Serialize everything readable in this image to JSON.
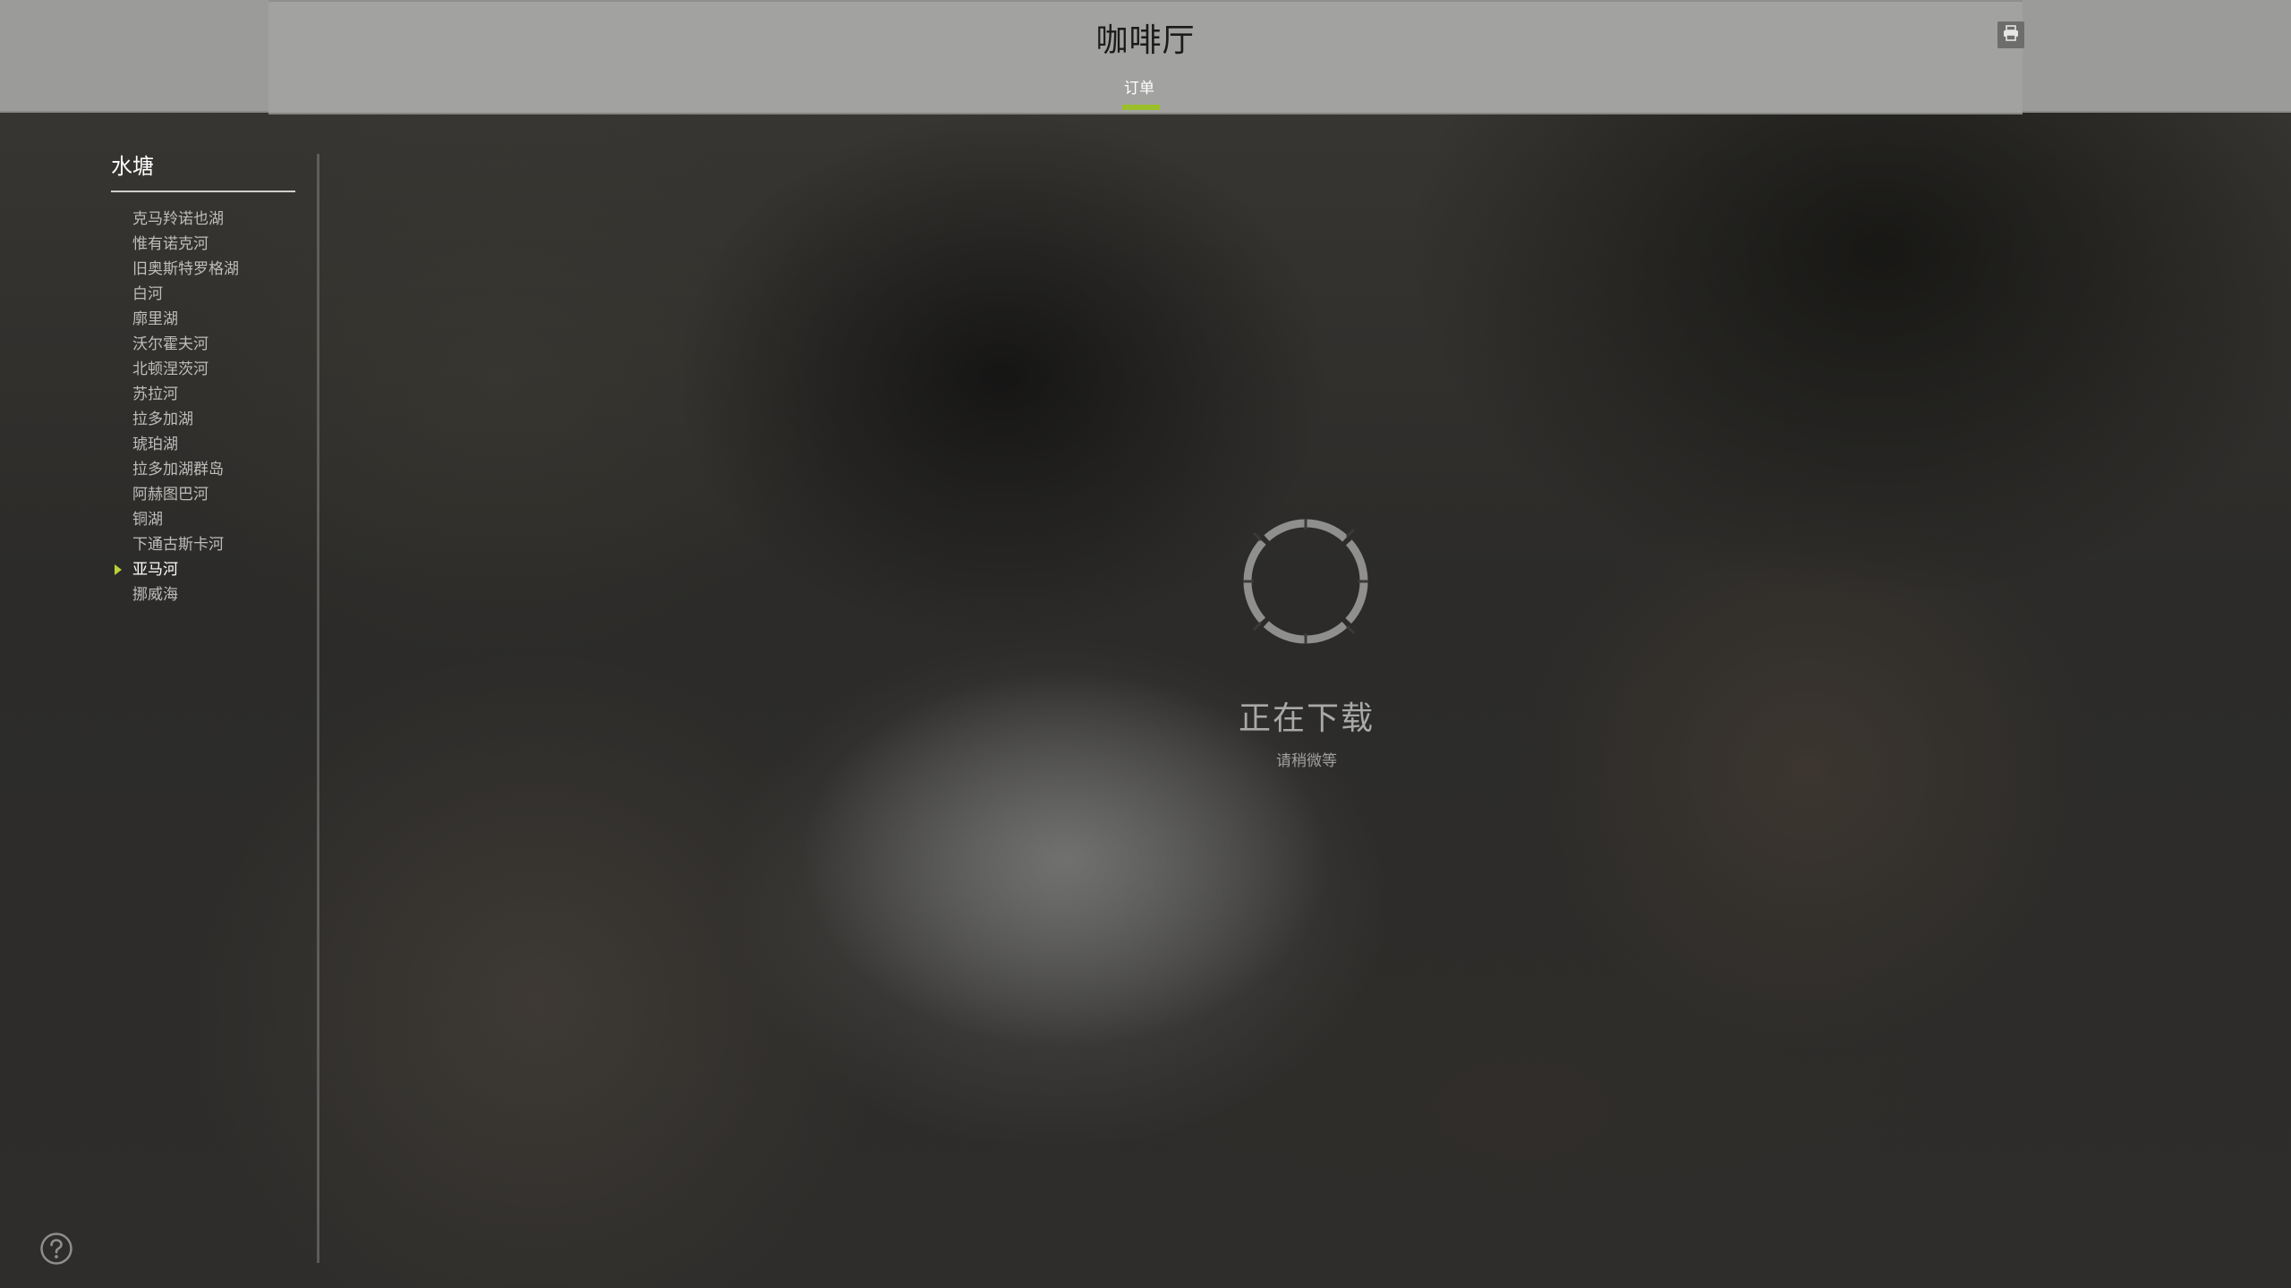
{
  "header": {
    "title": "咖啡厅",
    "tabs": [
      {
        "label": "订单",
        "active": true
      }
    ],
    "accent_color": "#9bbf2a",
    "right_icon": "printer-icon"
  },
  "sidebar": {
    "heading": "水塘",
    "items": [
      {
        "label": "克马羚诺也湖"
      },
      {
        "label": "惟有诺克河"
      },
      {
        "label": "旧奥斯特罗格湖"
      },
      {
        "label": "白河"
      },
      {
        "label": "廓里湖"
      },
      {
        "label": "沃尔霍夫河"
      },
      {
        "label": "北顿涅茨河"
      },
      {
        "label": "苏拉河"
      },
      {
        "label": "拉多加湖"
      },
      {
        "label": "琥珀湖"
      },
      {
        "label": "拉多加湖群岛"
      },
      {
        "label": "阿赫图巴河"
      },
      {
        "label": "铜湖"
      },
      {
        "label": "下通古斯卡河"
      },
      {
        "label": "亚马河",
        "active": true
      },
      {
        "label": "挪威海"
      }
    ],
    "active_marker_color": "#b7d23a"
  },
  "loading": {
    "title": "正在下载",
    "subtitle": "请稍微等",
    "icon": "loading-spinner-icon"
  },
  "help": {
    "icon": "help-icon"
  }
}
